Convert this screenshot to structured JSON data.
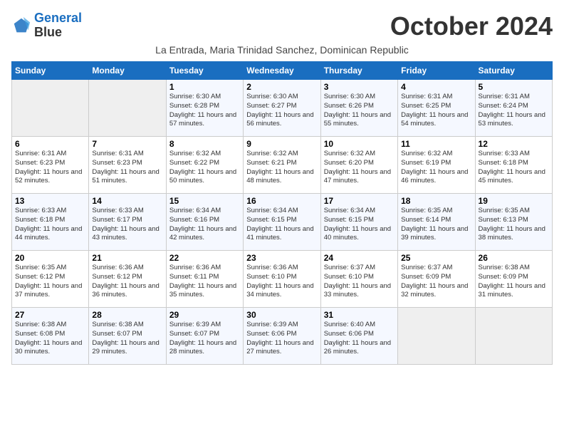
{
  "header": {
    "logo_line1": "General",
    "logo_line2": "Blue",
    "month": "October 2024",
    "subtitle": "La Entrada, Maria Trinidad Sanchez, Dominican Republic"
  },
  "weekdays": [
    "Sunday",
    "Monday",
    "Tuesday",
    "Wednesday",
    "Thursday",
    "Friday",
    "Saturday"
  ],
  "weeks": [
    [
      {
        "day": "",
        "info": ""
      },
      {
        "day": "",
        "info": ""
      },
      {
        "day": "1",
        "info": "Sunrise: 6:30 AM\nSunset: 6:28 PM\nDaylight: 11 hours and 57 minutes."
      },
      {
        "day": "2",
        "info": "Sunrise: 6:30 AM\nSunset: 6:27 PM\nDaylight: 11 hours and 56 minutes."
      },
      {
        "day": "3",
        "info": "Sunrise: 6:30 AM\nSunset: 6:26 PM\nDaylight: 11 hours and 55 minutes."
      },
      {
        "day": "4",
        "info": "Sunrise: 6:31 AM\nSunset: 6:25 PM\nDaylight: 11 hours and 54 minutes."
      },
      {
        "day": "5",
        "info": "Sunrise: 6:31 AM\nSunset: 6:24 PM\nDaylight: 11 hours and 53 minutes."
      }
    ],
    [
      {
        "day": "6",
        "info": "Sunrise: 6:31 AM\nSunset: 6:23 PM\nDaylight: 11 hours and 52 minutes."
      },
      {
        "day": "7",
        "info": "Sunrise: 6:31 AM\nSunset: 6:23 PM\nDaylight: 11 hours and 51 minutes."
      },
      {
        "day": "8",
        "info": "Sunrise: 6:32 AM\nSunset: 6:22 PM\nDaylight: 11 hours and 50 minutes."
      },
      {
        "day": "9",
        "info": "Sunrise: 6:32 AM\nSunset: 6:21 PM\nDaylight: 11 hours and 48 minutes."
      },
      {
        "day": "10",
        "info": "Sunrise: 6:32 AM\nSunset: 6:20 PM\nDaylight: 11 hours and 47 minutes."
      },
      {
        "day": "11",
        "info": "Sunrise: 6:32 AM\nSunset: 6:19 PM\nDaylight: 11 hours and 46 minutes."
      },
      {
        "day": "12",
        "info": "Sunrise: 6:33 AM\nSunset: 6:18 PM\nDaylight: 11 hours and 45 minutes."
      }
    ],
    [
      {
        "day": "13",
        "info": "Sunrise: 6:33 AM\nSunset: 6:18 PM\nDaylight: 11 hours and 44 minutes."
      },
      {
        "day": "14",
        "info": "Sunrise: 6:33 AM\nSunset: 6:17 PM\nDaylight: 11 hours and 43 minutes."
      },
      {
        "day": "15",
        "info": "Sunrise: 6:34 AM\nSunset: 6:16 PM\nDaylight: 11 hours and 42 minutes."
      },
      {
        "day": "16",
        "info": "Sunrise: 6:34 AM\nSunset: 6:15 PM\nDaylight: 11 hours and 41 minutes."
      },
      {
        "day": "17",
        "info": "Sunrise: 6:34 AM\nSunset: 6:15 PM\nDaylight: 11 hours and 40 minutes."
      },
      {
        "day": "18",
        "info": "Sunrise: 6:35 AM\nSunset: 6:14 PM\nDaylight: 11 hours and 39 minutes."
      },
      {
        "day": "19",
        "info": "Sunrise: 6:35 AM\nSunset: 6:13 PM\nDaylight: 11 hours and 38 minutes."
      }
    ],
    [
      {
        "day": "20",
        "info": "Sunrise: 6:35 AM\nSunset: 6:12 PM\nDaylight: 11 hours and 37 minutes."
      },
      {
        "day": "21",
        "info": "Sunrise: 6:36 AM\nSunset: 6:12 PM\nDaylight: 11 hours and 36 minutes."
      },
      {
        "day": "22",
        "info": "Sunrise: 6:36 AM\nSunset: 6:11 PM\nDaylight: 11 hours and 35 minutes."
      },
      {
        "day": "23",
        "info": "Sunrise: 6:36 AM\nSunset: 6:10 PM\nDaylight: 11 hours and 34 minutes."
      },
      {
        "day": "24",
        "info": "Sunrise: 6:37 AM\nSunset: 6:10 PM\nDaylight: 11 hours and 33 minutes."
      },
      {
        "day": "25",
        "info": "Sunrise: 6:37 AM\nSunset: 6:09 PM\nDaylight: 11 hours and 32 minutes."
      },
      {
        "day": "26",
        "info": "Sunrise: 6:38 AM\nSunset: 6:09 PM\nDaylight: 11 hours and 31 minutes."
      }
    ],
    [
      {
        "day": "27",
        "info": "Sunrise: 6:38 AM\nSunset: 6:08 PM\nDaylight: 11 hours and 30 minutes."
      },
      {
        "day": "28",
        "info": "Sunrise: 6:38 AM\nSunset: 6:07 PM\nDaylight: 11 hours and 29 minutes."
      },
      {
        "day": "29",
        "info": "Sunrise: 6:39 AM\nSunset: 6:07 PM\nDaylight: 11 hours and 28 minutes."
      },
      {
        "day": "30",
        "info": "Sunrise: 6:39 AM\nSunset: 6:06 PM\nDaylight: 11 hours and 27 minutes."
      },
      {
        "day": "31",
        "info": "Sunrise: 6:40 AM\nSunset: 6:06 PM\nDaylight: 11 hours and 26 minutes."
      },
      {
        "day": "",
        "info": ""
      },
      {
        "day": "",
        "info": ""
      }
    ]
  ]
}
